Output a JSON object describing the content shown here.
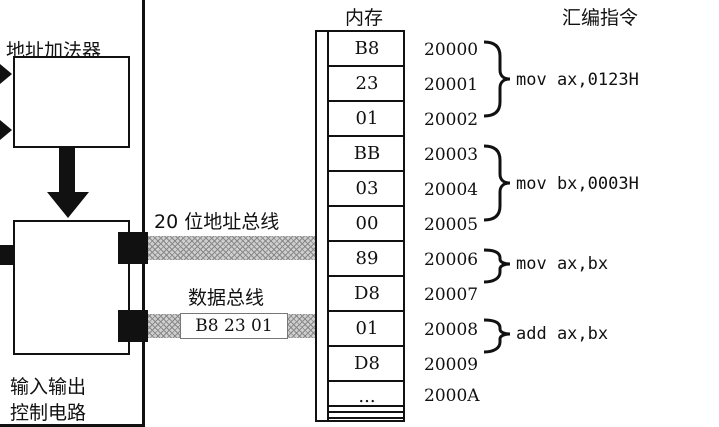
{
  "header": {
    "memory": "内存",
    "instructions": "汇编指令"
  },
  "cpu": {
    "adder_label": "地址加法器",
    "io_label_line1": "输入输出",
    "io_label_line2": "控制电路"
  },
  "buses": {
    "address_label": "20 位地址总线",
    "data_label": "数据总线",
    "data_value": "B8 23 01"
  },
  "memory": {
    "cells": [
      "B8",
      "23",
      "01",
      "BB",
      "03",
      "00",
      "89",
      "D8",
      "01",
      "D8",
      "..."
    ],
    "addresses": [
      "20000",
      "20001",
      "20002",
      "20003",
      "20004",
      "20005",
      "20006",
      "20007",
      "20008",
      "20009",
      "2000A"
    ]
  },
  "instructions": [
    "mov ax,0123H",
    "mov bx,0003H",
    "mov ax,bx",
    "add ax,bx"
  ]
}
